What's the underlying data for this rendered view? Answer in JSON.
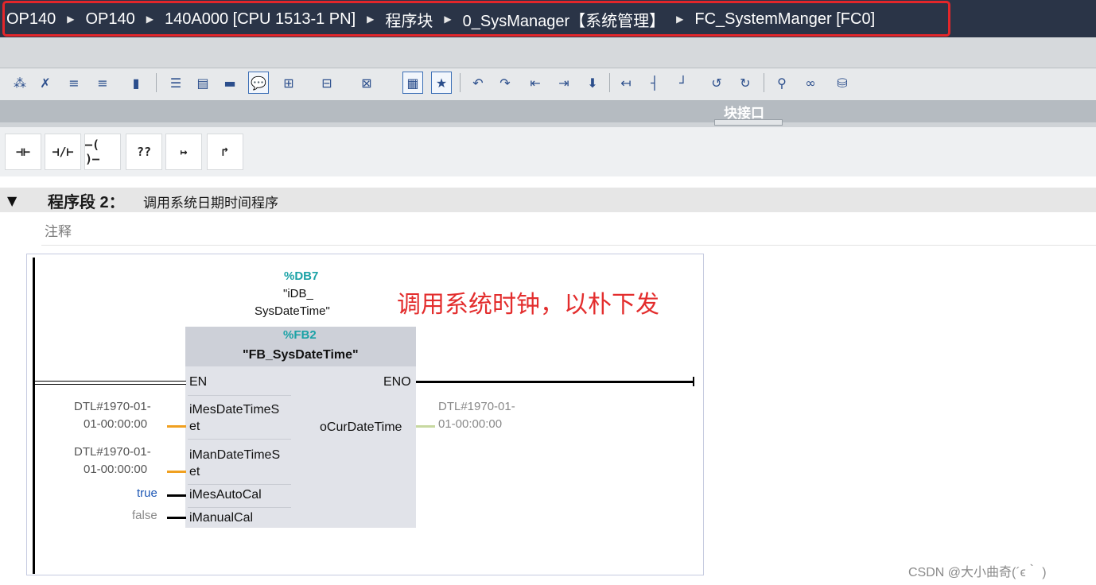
{
  "breadcrumb": {
    "items": [
      "OP140",
      "OP140",
      "140A000 [CPU 1513-1 PN]",
      "程序块",
      "0_SysManager【系统管理】",
      "FC_SystemManger [FC0]"
    ],
    "separator": "▶"
  },
  "interface": {
    "label": "块接口"
  },
  "ladder_tools": [
    "⊣⊢",
    "⊣/⊢",
    "–( )–",
    "??",
    "↦",
    "↱"
  ],
  "network": {
    "toggle": "▼",
    "title": "程序段 2：",
    "description": "调用系统日期时间程序",
    "comment_placeholder": "注释"
  },
  "instance": {
    "db_number": "%DB7",
    "db_name_line1": "\"iDB_",
    "db_name_line2": "SysDateTime\""
  },
  "block": {
    "fb_number": "%FB2",
    "fb_name": "\"FB_SysDateTime\"",
    "inputs": {
      "en": "EN",
      "mes_set_1": "iMesDateTimeS",
      "mes_set_2": "et",
      "man_set_1": "iManDateTimeS",
      "man_set_2": "et",
      "mes_auto": "iMesAutoCal",
      "manual": "iManualCal"
    },
    "outputs": {
      "eno": "ENO",
      "cur_time": "oCurDateTime"
    }
  },
  "params": {
    "mes_set_line1": "DTL#1970-01-",
    "mes_set_line2": "01-00:00:00",
    "man_set_line1": "DTL#1970-01-",
    "man_set_line2": "01-00:00:00",
    "auto_cal": "true",
    "manual_cal": "false",
    "out_line1": "DTL#1970-01-",
    "out_line2": "01-00:00:00"
  },
  "annotation": "调用系统时钟，以朴下发",
  "watermark": "CSDN @大小曲奇(´ϵ｀ )",
  "colors": {
    "breadcrumb_bg": "#2a3447",
    "highlight_box": "#e3262a",
    "db_label": "#1aa2a6",
    "annotation": "#e32d2d",
    "bool_true": "#1d57b5",
    "dtl_wire": "#f0a020"
  }
}
